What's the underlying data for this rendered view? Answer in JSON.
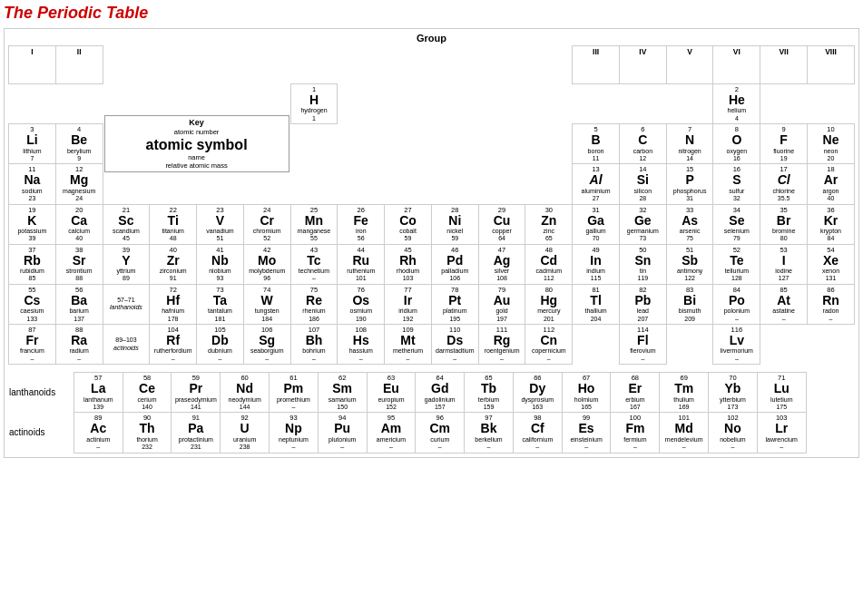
{
  "title": "The Periodic Table",
  "groupLabel": "Group",
  "columnHeaders": [
    "I",
    "II",
    "",
    "",
    "",
    "",
    "",
    "",
    "",
    "",
    "",
    "",
    "III",
    "IV",
    "V",
    "VI",
    "VII",
    "VIII"
  ],
  "key": {
    "title": "Key",
    "atomicNumberLabel": "atomic number",
    "atomicSymbolLabel": "atomic symbol",
    "nameLabel": "name",
    "relativeMassLabel": "relative atomic mass"
  },
  "elements": {
    "H": {
      "num": 1,
      "sym": "H",
      "name": "hydrogen",
      "mass": "1"
    },
    "He": {
      "num": 2,
      "sym": "He",
      "name": "helium",
      "mass": "4"
    },
    "Li": {
      "num": 3,
      "sym": "Li",
      "name": "lithium",
      "mass": "7"
    },
    "Be": {
      "num": 4,
      "sym": "Be",
      "name": "berylium",
      "mass": "9"
    },
    "B": {
      "num": 5,
      "sym": "B",
      "name": "boron",
      "mass": "11"
    },
    "C": {
      "num": 6,
      "sym": "C",
      "name": "carbon",
      "mass": "12"
    },
    "N": {
      "num": 7,
      "sym": "N",
      "name": "nitrogen",
      "mass": "14"
    },
    "O": {
      "num": 8,
      "sym": "O",
      "name": "oxygen",
      "mass": "16"
    },
    "F": {
      "num": 9,
      "sym": "F",
      "name": "fluorine",
      "mass": "19"
    },
    "Ne": {
      "num": 10,
      "sym": "Ne",
      "name": "neon",
      "mass": "20"
    },
    "Na": {
      "num": 11,
      "sym": "Na",
      "name": "sodium",
      "mass": "23"
    },
    "Mg": {
      "num": 12,
      "sym": "Mg",
      "name": "magnesium",
      "mass": "24"
    },
    "Al": {
      "num": 13,
      "sym": "Al",
      "name": "aluminium",
      "mass": "27"
    },
    "Si": {
      "num": 14,
      "sym": "Si",
      "name": "silicon",
      "mass": "28"
    },
    "P": {
      "num": 15,
      "sym": "P",
      "name": "phosphorus",
      "mass": "31"
    },
    "S": {
      "num": 16,
      "sym": "S",
      "name": "sulfur",
      "mass": "32"
    },
    "Cl": {
      "num": 17,
      "sym": "Cl",
      "name": "chlorine",
      "mass": "35.5"
    },
    "Ar": {
      "num": 18,
      "sym": "Ar",
      "name": "argon",
      "mass": "40"
    },
    "K": {
      "num": 19,
      "sym": "K",
      "name": "potassium",
      "mass": "39"
    },
    "Ca": {
      "num": 20,
      "sym": "Ca",
      "name": "calcium",
      "mass": "40"
    },
    "Sc": {
      "num": 21,
      "sym": "Sc",
      "name": "scandium",
      "mass": "45"
    },
    "Ti": {
      "num": 22,
      "sym": "Ti",
      "name": "titanium",
      "mass": "48"
    },
    "V": {
      "num": 23,
      "sym": "V",
      "name": "vanadium",
      "mass": "51"
    },
    "Cr": {
      "num": 24,
      "sym": "Cr",
      "name": "chromium",
      "mass": "52"
    },
    "Mn": {
      "num": 25,
      "sym": "Mn",
      "name": "manganese",
      "mass": "55"
    },
    "Fe": {
      "num": 26,
      "sym": "Fe",
      "name": "iron",
      "mass": "56"
    },
    "Co": {
      "num": 27,
      "sym": "Co",
      "name": "cobalt",
      "mass": "59"
    },
    "Ni": {
      "num": 28,
      "sym": "Ni",
      "name": "nickel",
      "mass": "59"
    },
    "Cu": {
      "num": 29,
      "sym": "Cu",
      "name": "copper",
      "mass": "64"
    },
    "Zn": {
      "num": 30,
      "sym": "Zn",
      "name": "zinc",
      "mass": "65"
    },
    "Ga": {
      "num": 31,
      "sym": "Ga",
      "name": "gallium",
      "mass": "70"
    },
    "Ge": {
      "num": 32,
      "sym": "Ge",
      "name": "germanium",
      "mass": "73"
    },
    "As": {
      "num": 33,
      "sym": "As",
      "name": "arsenic",
      "mass": "75"
    },
    "Se": {
      "num": 34,
      "sym": "Se",
      "name": "selenium",
      "mass": "79"
    },
    "Br": {
      "num": 35,
      "sym": "Br",
      "name": "bromine",
      "mass": "80"
    },
    "Kr": {
      "num": 36,
      "sym": "Kr",
      "name": "krypton",
      "mass": "84"
    },
    "Rb": {
      "num": 37,
      "sym": "Rb",
      "name": "rubidium",
      "mass": "85"
    },
    "Sr": {
      "num": 38,
      "sym": "Sr",
      "name": "strontium",
      "mass": "88"
    },
    "Y": {
      "num": 39,
      "sym": "Y",
      "name": "yttrium",
      "mass": "89"
    },
    "Zr": {
      "num": 40,
      "sym": "Zr",
      "name": "zirconium",
      "mass": "91"
    },
    "Nb": {
      "num": 41,
      "sym": "Nb",
      "name": "niobium",
      "mass": "93"
    },
    "Mo": {
      "num": 42,
      "sym": "Mo",
      "name": "molybdenum",
      "mass": "96"
    },
    "Tc": {
      "num": 43,
      "sym": "Tc",
      "name": "technetium",
      "mass": "–"
    },
    "Ru": {
      "num": 44,
      "sym": "Ru",
      "name": "ruthenium",
      "mass": "101"
    },
    "Rh": {
      "num": 45,
      "sym": "Rh",
      "name": "rhodium",
      "mass": "103"
    },
    "Pd": {
      "num": 46,
      "sym": "Pd",
      "name": "palladium",
      "mass": "106"
    },
    "Ag": {
      "num": 47,
      "sym": "Ag",
      "name": "silver",
      "mass": "108"
    },
    "Cd": {
      "num": 48,
      "sym": "Cd",
      "name": "cadmium",
      "mass": "112"
    },
    "In": {
      "num": 49,
      "sym": "In",
      "name": "indium",
      "mass": "115"
    },
    "Sn": {
      "num": 50,
      "sym": "Sn",
      "name": "tin",
      "mass": "119"
    },
    "Sb": {
      "num": 51,
      "sym": "Sb",
      "name": "antimony",
      "mass": "122"
    },
    "Te": {
      "num": 52,
      "sym": "Te",
      "name": "tellurium",
      "mass": "128"
    },
    "I": {
      "num": 53,
      "sym": "I",
      "name": "iodine",
      "mass": "127"
    },
    "Xe": {
      "num": 54,
      "sym": "Xe",
      "name": "xenon",
      "mass": "131"
    },
    "Cs": {
      "num": 55,
      "sym": "Cs",
      "name": "caesium",
      "mass": "133"
    },
    "Ba": {
      "num": 56,
      "sym": "Ba",
      "name": "barium",
      "mass": "137"
    },
    "Hf": {
      "num": 72,
      "sym": "Hf",
      "name": "hafnium",
      "mass": "178"
    },
    "Ta": {
      "num": 73,
      "sym": "Ta",
      "name": "tantalum",
      "mass": "181"
    },
    "W": {
      "num": 74,
      "sym": "W",
      "name": "tungsten",
      "mass": "184"
    },
    "Re": {
      "num": 75,
      "sym": "Re",
      "name": "rhenium",
      "mass": "186"
    },
    "Os": {
      "num": 76,
      "sym": "Os",
      "name": "osmium",
      "mass": "190"
    },
    "Ir": {
      "num": 77,
      "sym": "Ir",
      "name": "iridium",
      "mass": "192"
    },
    "Pt": {
      "num": 78,
      "sym": "Pt",
      "name": "platinum",
      "mass": "195"
    },
    "Au": {
      "num": 79,
      "sym": "Au",
      "name": "gold",
      "mass": "197"
    },
    "Hg": {
      "num": 80,
      "sym": "Hg",
      "name": "mercury",
      "mass": "201"
    },
    "Tl": {
      "num": 81,
      "sym": "Tl",
      "name": "thallium",
      "mass": "204"
    },
    "Pb": {
      "num": 82,
      "sym": "Pb",
      "name": "lead",
      "mass": "207"
    },
    "Bi": {
      "num": 83,
      "sym": "Bi",
      "name": "bismuth",
      "mass": "209"
    },
    "Po": {
      "num": 84,
      "sym": "Po",
      "name": "polonium",
      "mass": "–"
    },
    "At": {
      "num": 85,
      "sym": "At",
      "name": "astatine",
      "mass": "–"
    },
    "Rn": {
      "num": 86,
      "sym": "Rn",
      "name": "radon",
      "mass": "–"
    },
    "Fr": {
      "num": 87,
      "sym": "Fr",
      "name": "francium",
      "mass": "–"
    },
    "Ra": {
      "num": 88,
      "sym": "Ra",
      "name": "radium",
      "mass": "–"
    },
    "Rf": {
      "num": 104,
      "sym": "Rf",
      "name": "rutherfordium",
      "mass": "–"
    },
    "Db": {
      "num": 105,
      "sym": "Db",
      "name": "dubnium",
      "mass": "–"
    },
    "Sg": {
      "num": 106,
      "sym": "Sg",
      "name": "seaborgium",
      "mass": "–"
    },
    "Bh": {
      "num": 107,
      "sym": "Bh",
      "name": "bohrium",
      "mass": "–"
    },
    "Hs": {
      "num": 108,
      "sym": "Hs",
      "name": "hassium",
      "mass": "–"
    },
    "Mt": {
      "num": 109,
      "sym": "Mt",
      "name": "metherium",
      "mass": "–"
    },
    "Ds": {
      "num": 110,
      "sym": "Ds",
      "name": "darmstadtium",
      "mass": "–"
    },
    "Rg": {
      "num": 111,
      "sym": "Rg",
      "name": "roentgenium",
      "mass": "–"
    },
    "Cn": {
      "num": 112,
      "sym": "Cn",
      "name": "copernicium",
      "mass": "–"
    },
    "Fl": {
      "num": 114,
      "sym": "Fl",
      "name": "flerovium",
      "mass": "–"
    },
    "Lv": {
      "num": 116,
      "sym": "Lv",
      "name": "livermorium",
      "mass": "–"
    },
    "La": {
      "num": 57,
      "sym": "La",
      "name": "lanthanum",
      "mass": "139"
    },
    "Ce": {
      "num": 58,
      "sym": "Ce",
      "name": "cerium",
      "mass": "140"
    },
    "Pr": {
      "num": 59,
      "sym": "Pr",
      "name": "praseodymium",
      "mass": "141"
    },
    "Nd": {
      "num": 60,
      "sym": "Nd",
      "name": "neodymium",
      "mass": "144"
    },
    "Pm": {
      "num": 61,
      "sym": "Pm",
      "name": "promethium",
      "mass": "–"
    },
    "Sm": {
      "num": 62,
      "sym": "Sm",
      "name": "samarium",
      "mass": "150"
    },
    "Eu": {
      "num": 63,
      "sym": "Eu",
      "name": "europium",
      "mass": "152"
    },
    "Gd": {
      "num": 64,
      "sym": "Gd",
      "name": "gadolinium",
      "mass": "157"
    },
    "Tb": {
      "num": 65,
      "sym": "Tb",
      "name": "terbium",
      "mass": "159"
    },
    "Dy": {
      "num": 66,
      "sym": "Dy",
      "name": "dysprosium",
      "mass": "163"
    },
    "Ho": {
      "num": 67,
      "sym": "Ho",
      "name": "holmium",
      "mass": "165"
    },
    "Er": {
      "num": 68,
      "sym": "Er",
      "name": "erbium",
      "mass": "167"
    },
    "Tm": {
      "num": 69,
      "sym": "Tm",
      "name": "thulium",
      "mass": "169"
    },
    "Yb": {
      "num": 70,
      "sym": "Yb",
      "name": "ytterbium",
      "mass": "173"
    },
    "Lu": {
      "num": 71,
      "sym": "Lu",
      "name": "lutetium",
      "mass": "175"
    },
    "Ac": {
      "num": 89,
      "sym": "Ac",
      "name": "actinium",
      "mass": "–"
    },
    "Th": {
      "num": 90,
      "sym": "Th",
      "name": "thorium",
      "mass": "232"
    },
    "Pa": {
      "num": 91,
      "sym": "Pa",
      "name": "protactinium",
      "mass": "231"
    },
    "U": {
      "num": 92,
      "sym": "U",
      "name": "uranium",
      "mass": "238"
    },
    "Np": {
      "num": 93,
      "sym": "Np",
      "name": "neptunium",
      "mass": "–"
    },
    "Pu": {
      "num": 94,
      "sym": "Pu",
      "name": "plutonium",
      "mass": "–"
    },
    "Am": {
      "num": 95,
      "sym": "Am",
      "name": "americium",
      "mass": "–"
    },
    "Cm": {
      "num": 96,
      "sym": "Cm",
      "name": "curium",
      "mass": "–"
    },
    "Bk": {
      "num": 97,
      "sym": "Bk",
      "name": "berkelium",
      "mass": "–"
    },
    "Cf": {
      "num": 98,
      "sym": "Cf",
      "name": "californium",
      "mass": "–"
    },
    "Es": {
      "num": 99,
      "sym": "Es",
      "name": "einsteinium",
      "mass": "–"
    },
    "Fm": {
      "num": 100,
      "sym": "Fm",
      "name": "fermium",
      "mass": "–"
    },
    "Md": {
      "num": 101,
      "sym": "Md",
      "name": "mendelevium",
      "mass": "–"
    },
    "No": {
      "num": 102,
      "sym": "No",
      "name": "nobelium",
      "mass": "–"
    },
    "Lr": {
      "num": 103,
      "sym": "Lr",
      "name": "lawrencium",
      "mass": "–"
    }
  },
  "lanthanoidLabel": "lanthanoids",
  "actinoidLabel": "actinoids",
  "lanthanoidsRange": "57–71",
  "actinoidsRange": "89–103"
}
